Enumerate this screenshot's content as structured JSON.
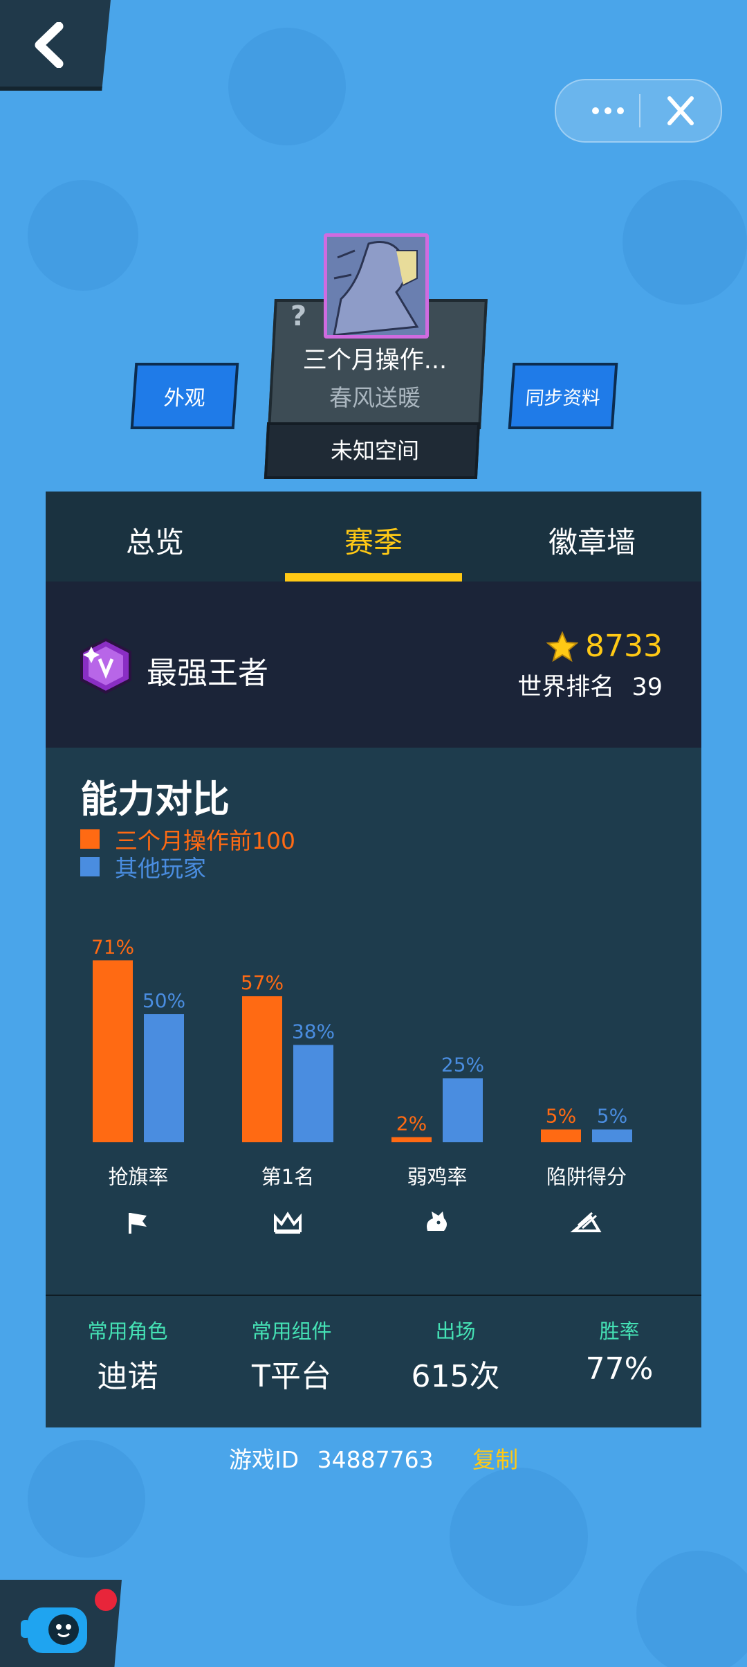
{
  "header": {
    "back_icon": "back-chevron-icon",
    "more_icon": "more-dots-icon",
    "close_icon": "close-icon"
  },
  "profile": {
    "name": "三个月操作...",
    "subtitle": "春风送暖",
    "space": "未知空间",
    "look_button": "外观",
    "sync_button": "同步资料"
  },
  "tabs": [
    {
      "label": "总览",
      "active": false
    },
    {
      "label": "赛季",
      "active": true
    },
    {
      "label": "徽章墙",
      "active": false
    }
  ],
  "rank": {
    "name": "最强王者",
    "score": "8733",
    "world_rank_label": "世界排名",
    "world_rank_value": "39"
  },
  "compare": {
    "title": "能力对比",
    "legend": [
      {
        "label": "三个月操作前100",
        "color": "#ff6a13"
      },
      {
        "label": "其他玩家",
        "color": "#4a8de0"
      }
    ]
  },
  "chart_data": {
    "type": "bar",
    "categories": [
      "抢旗率",
      "第1名",
      "弱鸡率",
      "陷阱得分"
    ],
    "series": [
      {
        "name": "三个月操作前100",
        "values": [
          71,
          57,
          2,
          5
        ],
        "color": "#ff6a13"
      },
      {
        "name": "其他玩家",
        "values": [
          50,
          38,
          25,
          5
        ],
        "color": "#4a8de0"
      }
    ],
    "category_icons": [
      "flag-icon",
      "crown-icon",
      "chicken-icon",
      "trap-icon"
    ],
    "unit": "%"
  },
  "stats": [
    {
      "label": "常用角色",
      "value": "迪诺"
    },
    {
      "label": "常用组件",
      "value": "T平台"
    },
    {
      "label": "出场",
      "value": "615次"
    },
    {
      "label": "胜率",
      "value": "77%"
    }
  ],
  "footer": {
    "game_id_label": "游戏ID",
    "game_id": "34887763",
    "copy": "复制"
  }
}
